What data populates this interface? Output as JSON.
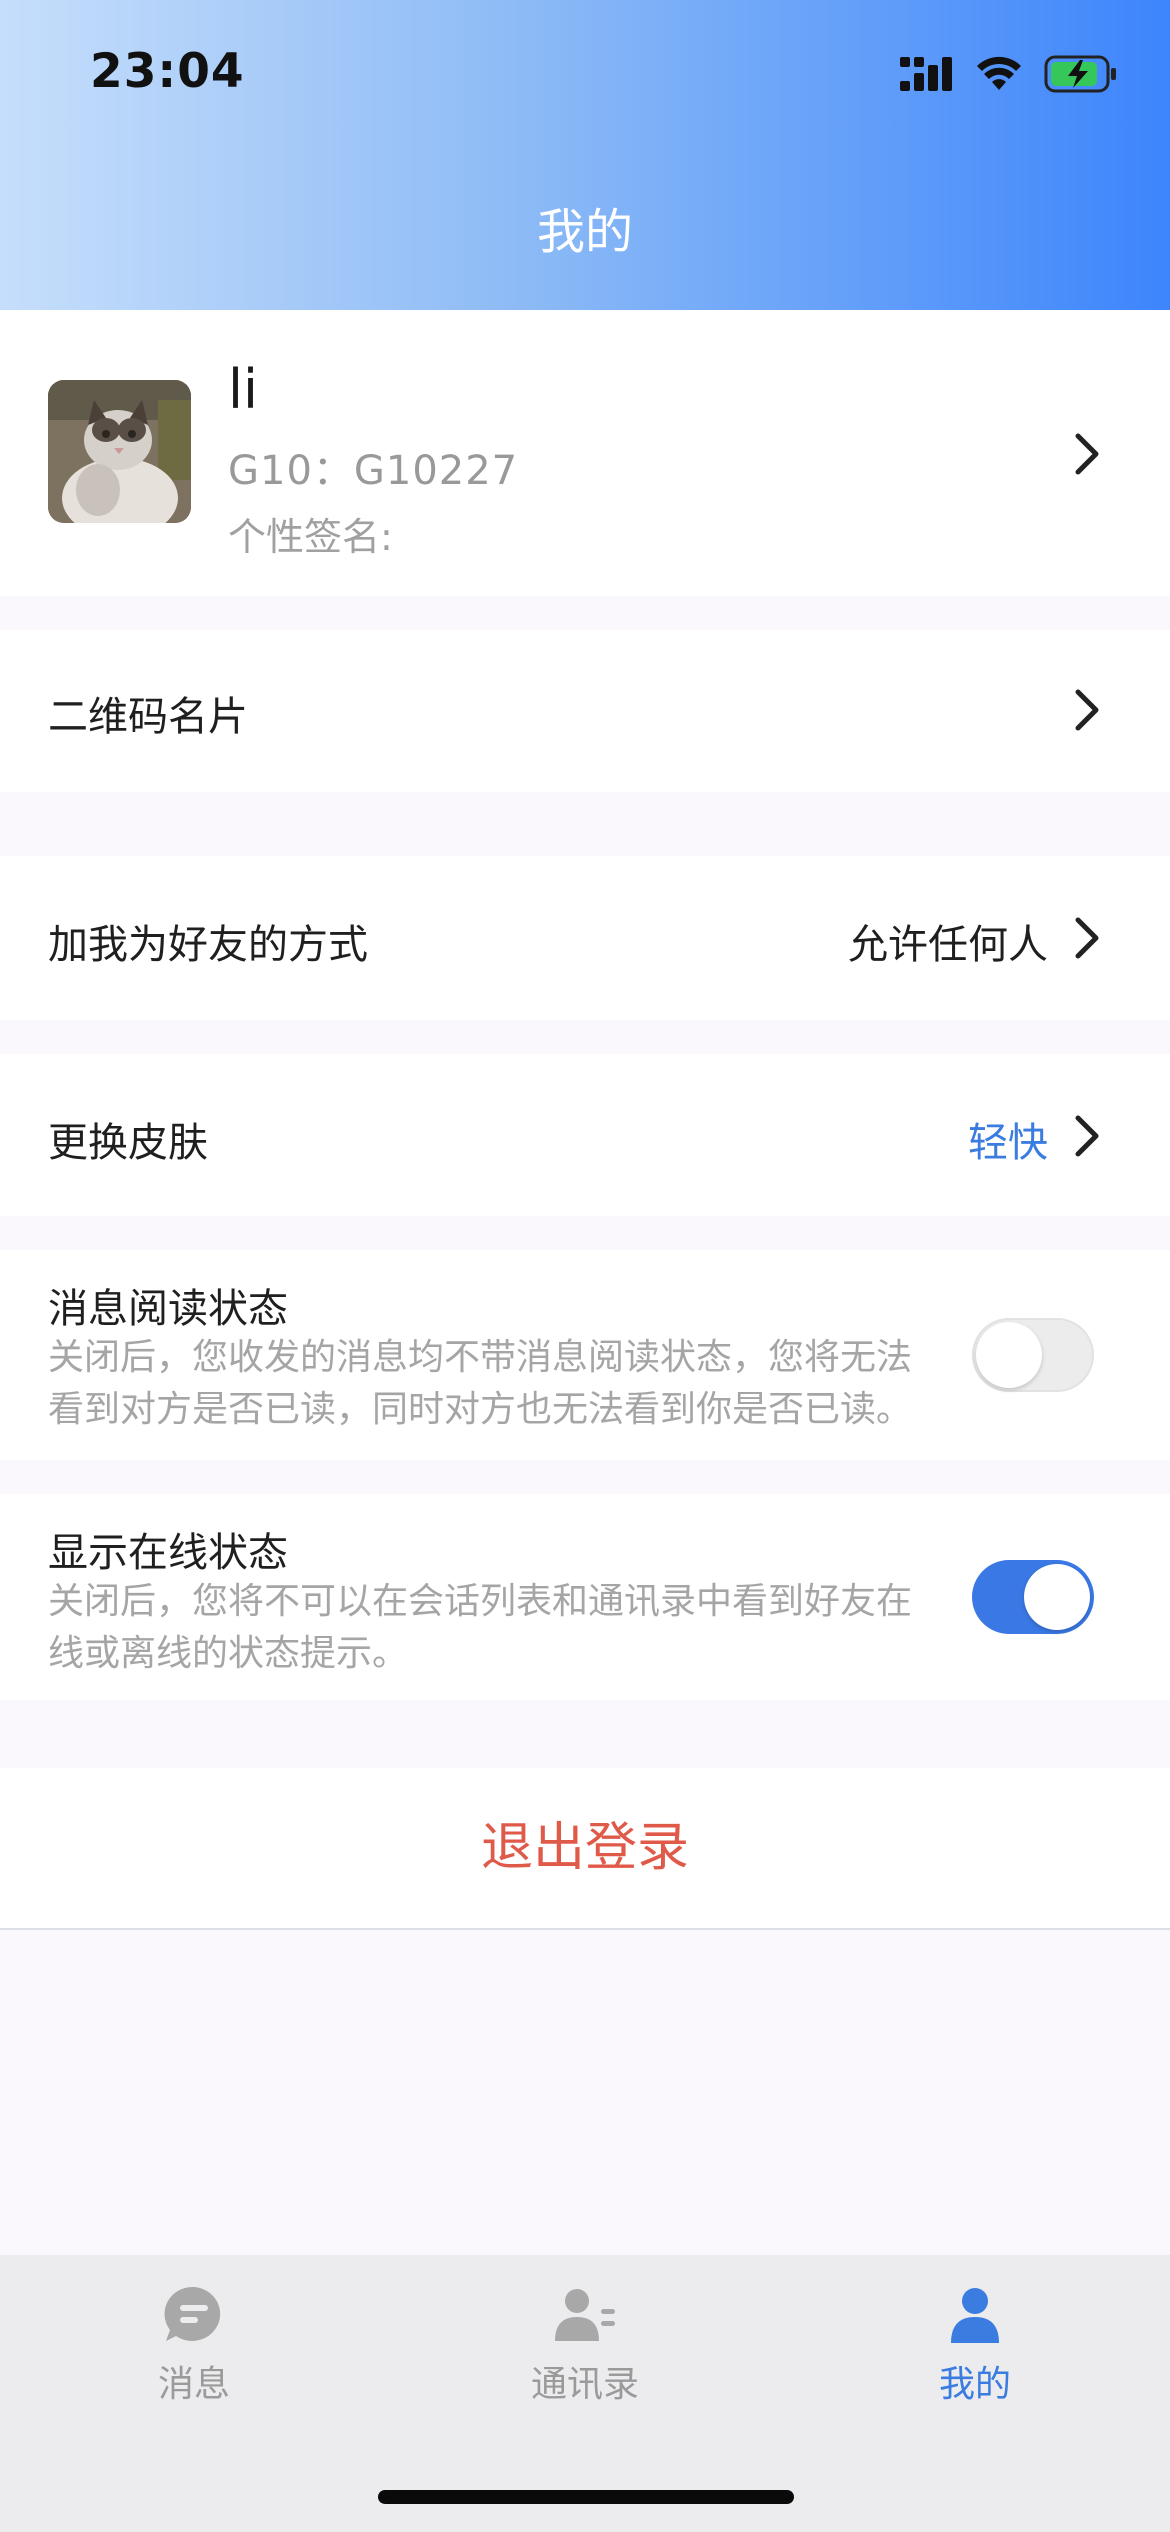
{
  "status_bar": {
    "time": "23:04"
  },
  "header": {
    "title": "我的"
  },
  "profile": {
    "name": "li",
    "id_line": "G10：G10227",
    "signature_label": "个性签名:"
  },
  "rows": {
    "qr_card": {
      "label": "二维码名片"
    },
    "friend_method": {
      "label": "加我为好友的方式",
      "value": "允许任何人"
    },
    "skin": {
      "label": "更换皮肤",
      "value": "轻快"
    },
    "read_status": {
      "label": "消息阅读状态",
      "desc_line1": "关闭后，您收发的消息均不带消息阅读状态，您将无法",
      "desc_line2": "看到对方是否已读，同时对方也无法看到你是否已读。",
      "enabled": false
    },
    "online_status": {
      "label": "显示在线状态",
      "desc_line1": "关闭后，您将不可以在会话列表和通讯录中看到好友在",
      "desc_line2": "线或离线的状态提示。",
      "enabled": true
    }
  },
  "logout": {
    "label": "退出登录"
  },
  "tabbar": {
    "tabs": [
      {
        "label": "消息",
        "icon": "message-icon",
        "active": false
      },
      {
        "label": "通讯录",
        "icon": "contacts-icon",
        "active": false
      },
      {
        "label": "我的",
        "icon": "me-icon",
        "active": true
      }
    ]
  },
  "colors": {
    "accent": "#3a7ce0",
    "danger": "#e05a4a",
    "header_gradient_start": "#c6defb",
    "header_gradient_end": "#3d85fc"
  }
}
